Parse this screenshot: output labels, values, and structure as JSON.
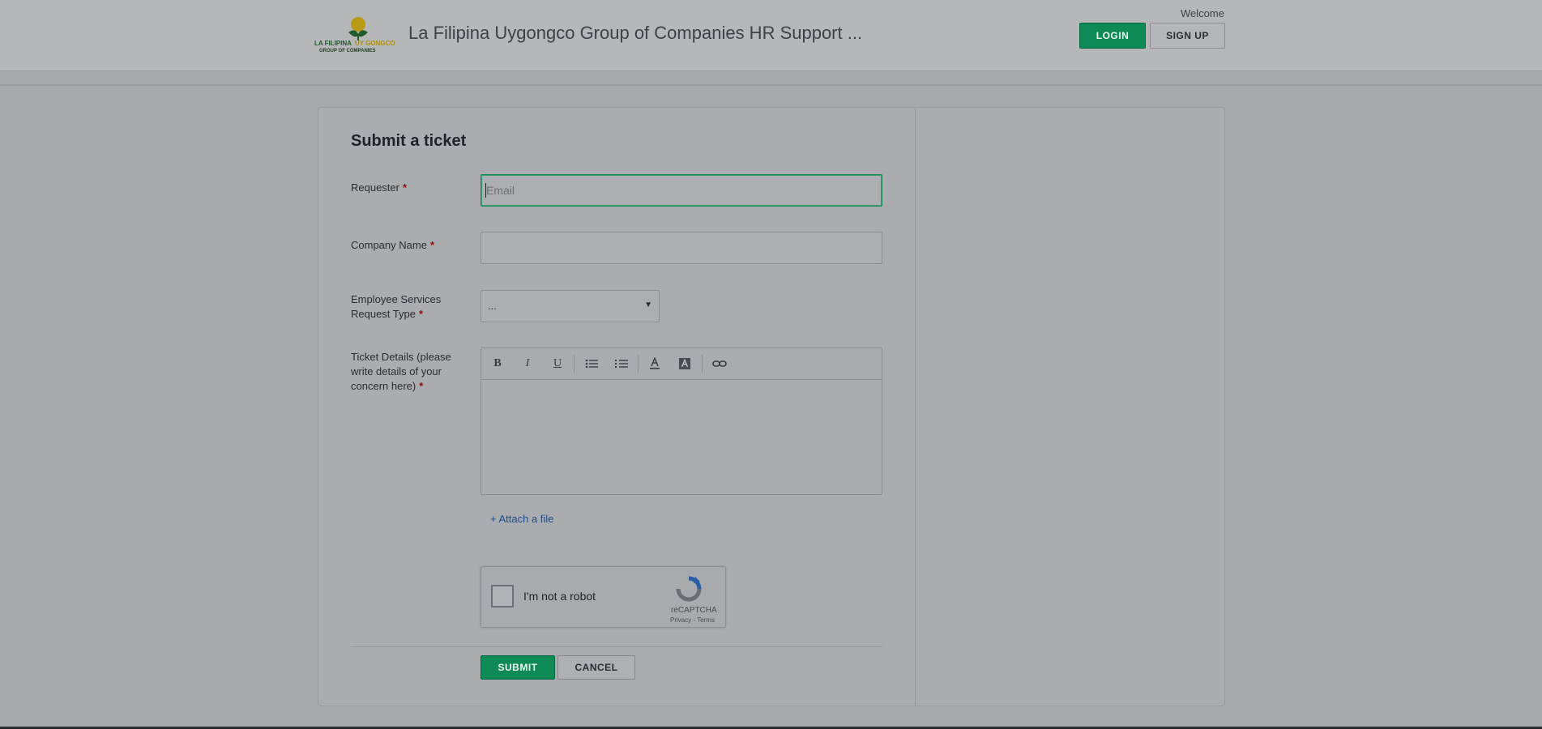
{
  "header": {
    "logo_text_line1": "LA FILIPINA UY GONGCO",
    "logo_text_line2": "GROUP OF COMPANIES",
    "site_title": "La Filipina Uygongco Group of Companies HR Support ...",
    "welcome": "Welcome",
    "login_label": "LOGIN",
    "signup_label": "SIGN UP"
  },
  "form": {
    "title": "Submit a ticket",
    "requester": {
      "label": "Requester",
      "required": "*",
      "placeholder": "Email",
      "value": ""
    },
    "company": {
      "label": "Company Name",
      "required": "*",
      "value": ""
    },
    "request_type": {
      "label_line1": "Employee Services",
      "label_line2": "Request Type",
      "required": "*",
      "selected": "..."
    },
    "details": {
      "label_line1": "Ticket Details (please",
      "label_line2": "write details of your",
      "label_line3": "concern here)",
      "required": "*"
    },
    "toolbar": {
      "bold": "B",
      "italic": "I",
      "underline": "U"
    },
    "attach_label": "+ Attach a file",
    "captcha": {
      "text": "I'm not a robot",
      "brand": "reCAPTCHA",
      "links": "Privacy - Terms"
    },
    "submit_label": "SUBMIT",
    "cancel_label": "CANCEL"
  },
  "colors": {
    "primary": "#0d8a55",
    "overlay_bg": "#a7a9ac",
    "required": "#8a1111"
  }
}
